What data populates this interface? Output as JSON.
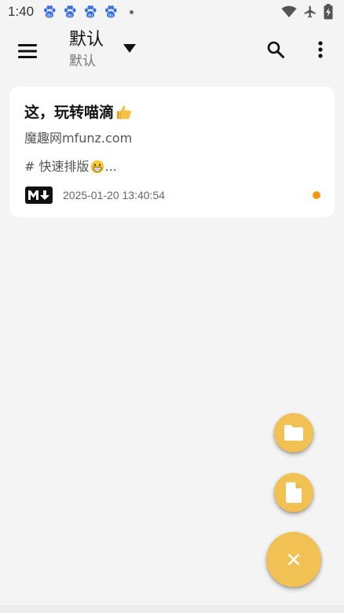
{
  "status_bar": {
    "time": "1:40",
    "notification_icons": [
      "baidu-paw-icon",
      "baidu-paw-icon",
      "baidu-paw-icon",
      "baidu-paw-icon"
    ],
    "system_icons": [
      "wifi-icon",
      "airplane-mode-icon",
      "battery-charging-icon"
    ]
  },
  "app_bar": {
    "title": "默认",
    "subtitle": "默认",
    "icons": [
      "menu-icon",
      "dropdown-triangle-icon",
      "search-icon",
      "more-vertical-icon"
    ]
  },
  "notes": [
    {
      "title": "这，玩转喵滴",
      "title_emoji": "thumbs-up-emoji",
      "subtitle": "魔趣网mfunz.com",
      "preview_prefix": "# 快速排版",
      "preview_emoji": "grinning-emoji",
      "preview_suffix": "...",
      "format_icon": "markdown-icon",
      "timestamp": "2025-01-20 13:40:54",
      "status_color": "#f39a12"
    }
  ],
  "fabs": {
    "folder_icon": "folder-icon",
    "file_icon": "file-icon",
    "close_icon": "close-icon",
    "color": "#f2c153"
  },
  "colors": {
    "background": "#f4f4f4",
    "card": "#ffffff",
    "accent": "#f2c153",
    "unread_dot": "#f39a12"
  }
}
